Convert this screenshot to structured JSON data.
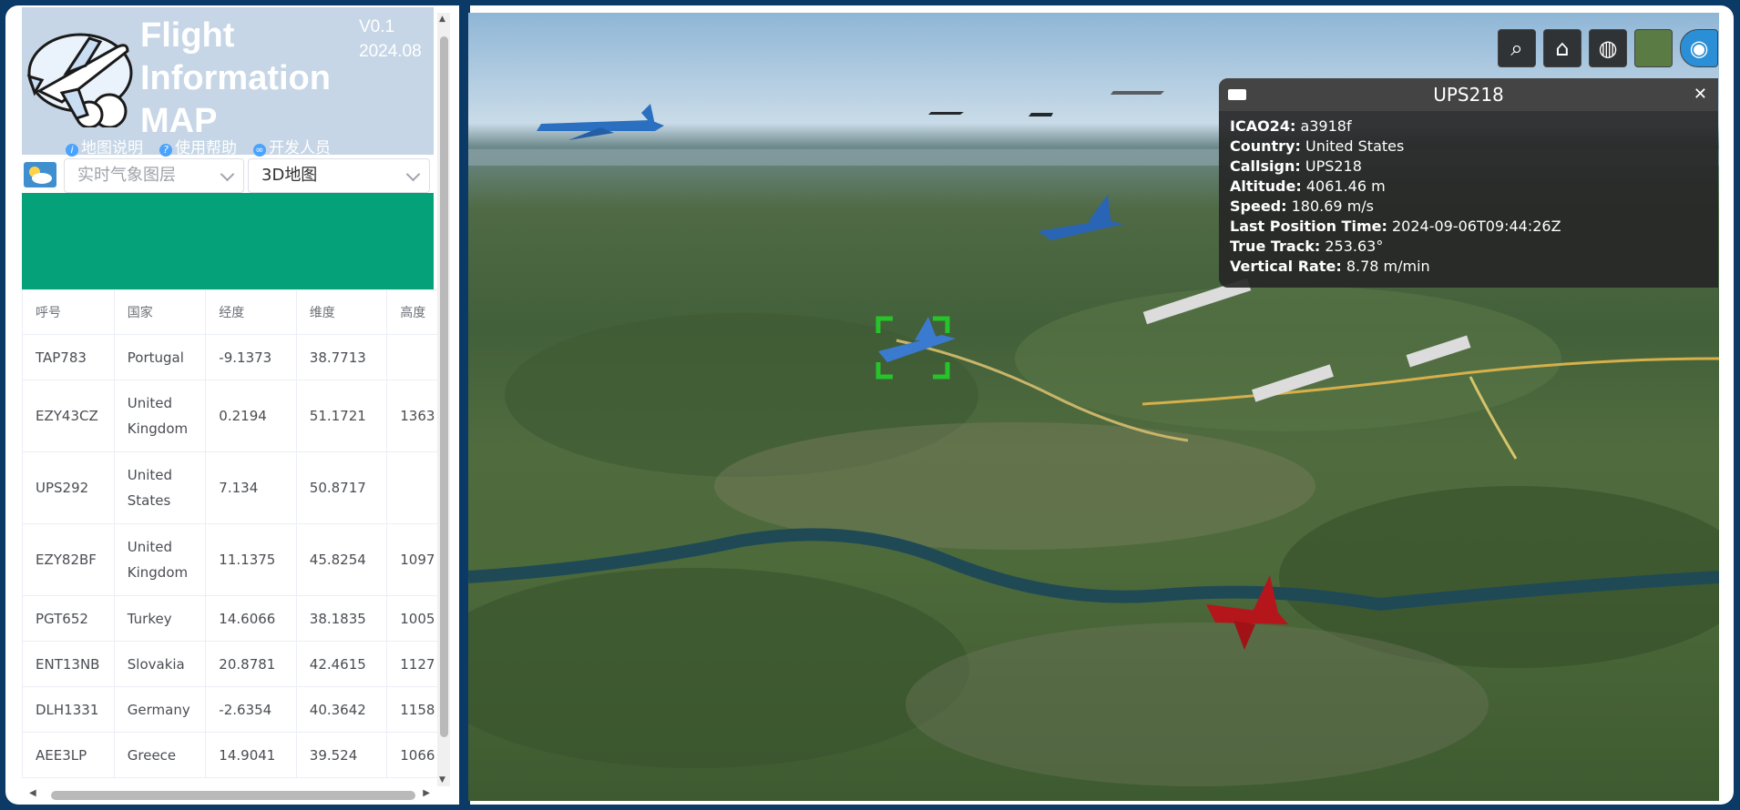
{
  "app": {
    "title_lines": [
      "Flight",
      "Information",
      "MAP"
    ],
    "version": "V0.1",
    "date": "2024.08"
  },
  "links": [
    {
      "label": "地图说明",
      "icon": "info-icon"
    },
    {
      "label": "使用帮助",
      "icon": "help-icon"
    },
    {
      "label": "开发人员",
      "icon": "link-icon"
    }
  ],
  "toolbar": {
    "weather_select": "实时气象图层",
    "map_select": "3D地图"
  },
  "table": {
    "headers": [
      "呼号",
      "国家",
      "经度",
      "维度",
      "高度"
    ],
    "rows": [
      [
        "TAP783",
        "Portugal",
        "-9.1373",
        "38.7713",
        ""
      ],
      [
        "EZY43CZ",
        "United Kingdom",
        "0.2194",
        "51.1721",
        "1363"
      ],
      [
        "UPS292",
        "United States",
        "7.134",
        "50.8717",
        ""
      ],
      [
        "EZY82BF",
        "United Kingdom",
        "11.1375",
        "45.8254",
        "1097"
      ],
      [
        "PGT652",
        "Turkey",
        "14.6066",
        "38.1835",
        "1005"
      ],
      [
        "ENT13NB",
        "Slovakia",
        "20.8781",
        "42.4615",
        "1127"
      ],
      [
        "DLH1331",
        "Germany",
        "-2.6354",
        "40.3642",
        "1158"
      ],
      [
        "AEE3LP",
        "Greece",
        "14.9041",
        "39.524",
        "1066"
      ]
    ]
  },
  "map_buttons": [
    "search-icon",
    "home-icon",
    "globe-icon",
    "layers-icon",
    "visibility-icon"
  ],
  "info": {
    "title": "UPS218",
    "fields": [
      {
        "label": "ICAO24:",
        "value": "a3918f"
      },
      {
        "label": "Country:",
        "value": "United States"
      },
      {
        "label": "Callsign:",
        "value": "UPS218"
      },
      {
        "label": "Altitude:",
        "value": "4061.46 m"
      },
      {
        "label": "Speed:",
        "value": "180.69 m/s"
      },
      {
        "label": "Last Position Time:",
        "value": "2024-09-06T09:44:26Z"
      },
      {
        "label": "True Track:",
        "value": "253.63°"
      },
      {
        "label": "Vertical Rate:",
        "value": "8.78 m/min"
      }
    ]
  }
}
